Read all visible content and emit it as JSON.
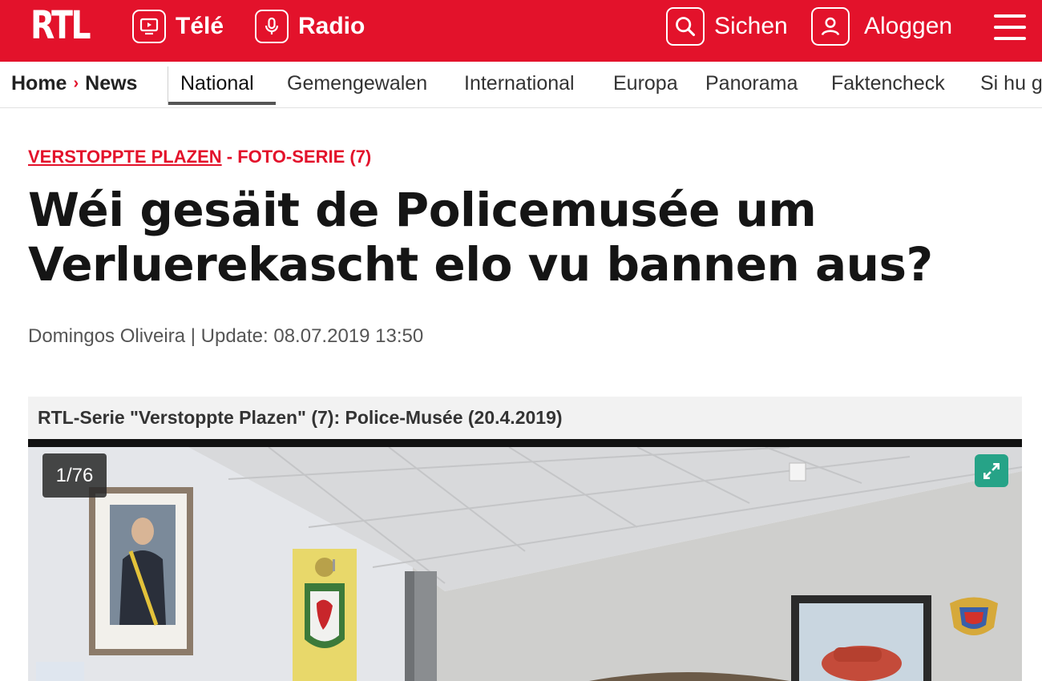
{
  "header": {
    "logo": "RTL",
    "tele_label": "Télé",
    "radio_label": "Radio",
    "search_label": "Sichen",
    "login_label": "Aloggen",
    "accent_color": "#e3122b"
  },
  "breadcrumb": {
    "home": "Home",
    "separator": "›",
    "section": "News"
  },
  "subnav": {
    "items": [
      "National",
      "Gemengewalen",
      "International",
      "Europa",
      "Panorama",
      "Faktencheck",
      "Si hu g"
    ],
    "active": "National"
  },
  "article": {
    "kicker_link": "VERSTOPPTE PLAZEN",
    "kicker_suffix": "- FOTO-SERIE (7)",
    "headline_line1": "Wéi gesäit de Policemusée um",
    "headline_line2": "Verluerekascht elo vu bannen aus?",
    "byline": "Domingos Oliveira | Update: 08.07.2019 13:50"
  },
  "gallery": {
    "caption": "RTL-Serie \"Verstoppte Plazen\" (7): Police-Musée (20.4.2019)",
    "counter": "1/76",
    "expand_icon": "expand-icon"
  }
}
